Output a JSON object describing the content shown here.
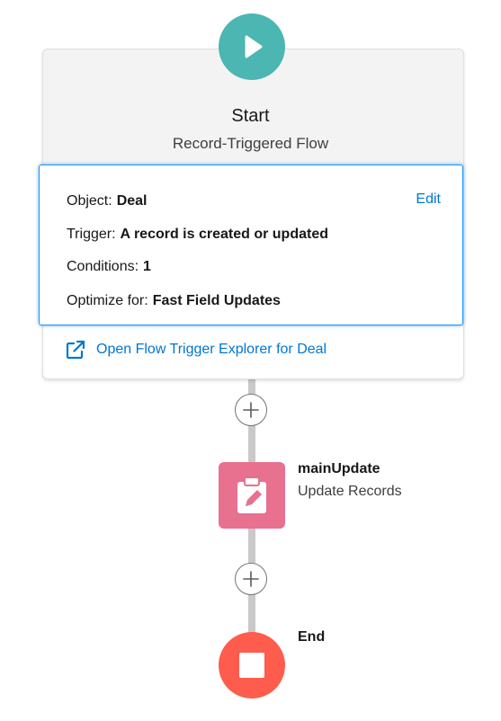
{
  "start": {
    "title": "Start",
    "subtitle": "Record-Triggered Flow",
    "object_label": "Object:",
    "object_value": "Deal",
    "trigger_label": "Trigger:",
    "trigger_value": "A record is created or updated",
    "conditions_label": "Conditions:",
    "conditions_value": "1",
    "optimize_label": "Optimize for:",
    "optimize_value": "Fast Field Updates",
    "edit_label": "Edit",
    "explorer_link": "Open Flow Trigger Explorer for Deal"
  },
  "elements": [
    {
      "name": "mainUpdate",
      "type": "Update Records",
      "icon": "clipboard-edit-icon",
      "color": "#e7718f"
    }
  ],
  "end": {
    "label": "End",
    "icon": "stop-icon",
    "color": "#fe5c4c"
  },
  "colors": {
    "start": "#4bb6b2",
    "link": "#0176d3",
    "connector": "#c9c9c9",
    "selection_border": "#1b96ff"
  },
  "icons": {
    "start": "play-icon",
    "add": "plus-icon",
    "external_link": "external-link-icon"
  }
}
